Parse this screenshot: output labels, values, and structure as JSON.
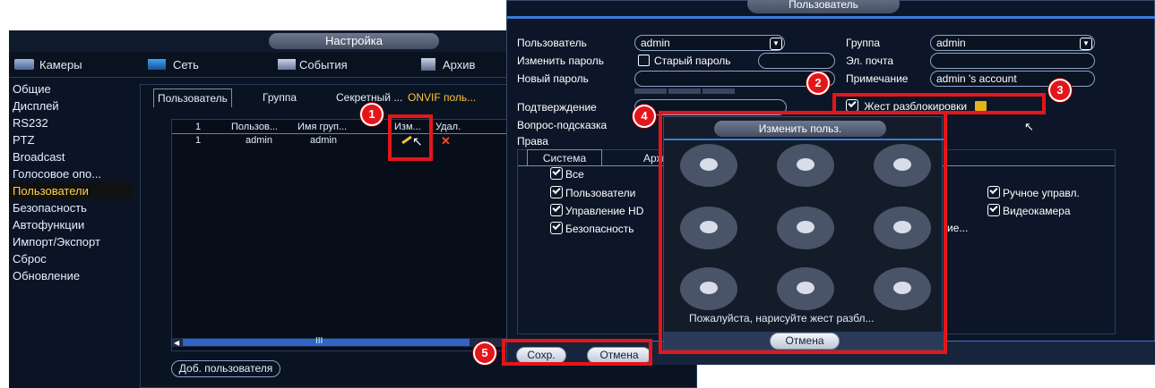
{
  "settings": {
    "title": "Настройка",
    "toolbar": [
      {
        "icon": "cameras-icon",
        "label": "Камеры"
      },
      {
        "icon": "network-icon",
        "label": "Сеть"
      },
      {
        "icon": "events-icon",
        "label": "События"
      },
      {
        "icon": "archive-icon",
        "label": "Архив"
      }
    ],
    "menu": [
      "Общие",
      "Дисплей",
      "RS232",
      "PTZ",
      "Broadcast",
      "Голосовое опо...",
      "Пользователи",
      "Безопасность",
      "Автофункции",
      "Импорт/Экспорт",
      "Сброс",
      "Обновление"
    ],
    "active_menu": "Пользователи",
    "tabs": [
      "Пользователь",
      "Группа",
      "Секретный ...",
      "ONVIF поль..."
    ],
    "table": {
      "headers": [
        "1",
        "Пользов...",
        "Имя груп...",
        "Изм...",
        "Удал."
      ],
      "rows": [
        {
          "num": "1",
          "user": "admin",
          "group": "admin"
        }
      ]
    },
    "add_user": "Доб. пользователя",
    "scroll_mid": "III"
  },
  "user_dialog": {
    "title": "Пользователь",
    "labels": {
      "user": "Пользователь",
      "change_password": "Изменить пароль",
      "new_password": "Новый пароль",
      "confirm": "Подтверждение",
      "hint_question": "Вопрос-подсказка",
      "rights": "Права",
      "group": "Группа",
      "email": "Эл. почта",
      "note": "Примечание"
    },
    "values": {
      "user": "admin",
      "old_password_label": "Старый пароль",
      "group": "admin",
      "note": "admin 's account"
    },
    "gesture_unlock": "Жест разблокировки",
    "perm_tabs": [
      "Система",
      "Архи"
    ],
    "perms_left": [
      "Все",
      "Пользователи",
      "Управление HD",
      "Безопасность"
    ],
    "perms_right": [
      "Ручное управл.",
      "Видеокамера"
    ],
    "perm_partial": "ие...",
    "save": "Сохр.",
    "cancel": "Отмена"
  },
  "gesture_dialog": {
    "title": "Изменить польз.",
    "prompt": "Пожалуйста, нарисуйте жест разбл...",
    "cancel": "Отмена"
  },
  "callouts": [
    "1",
    "2",
    "3",
    "4",
    "5"
  ]
}
